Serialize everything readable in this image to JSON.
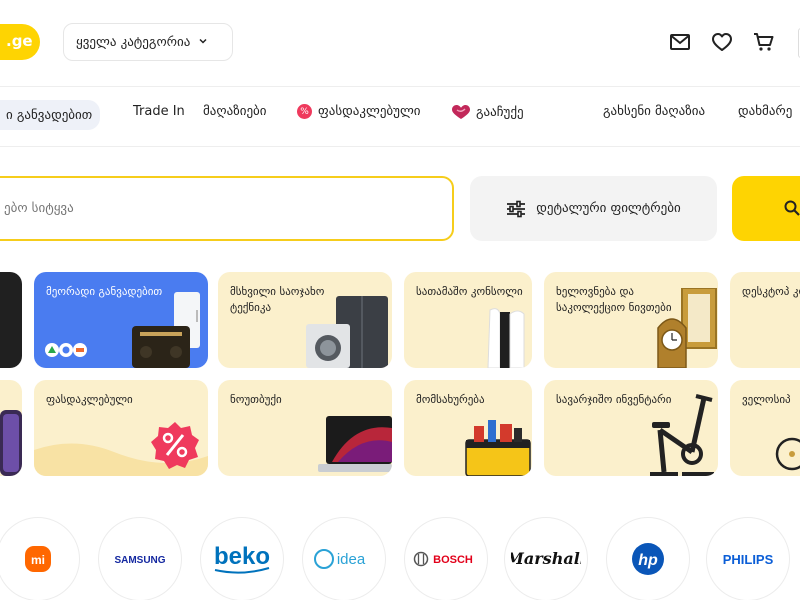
{
  "header": {
    "logo_text": ".ge",
    "category_button": "ყველა კატეგორია",
    "icons": [
      "mail-icon",
      "heart-icon",
      "cart-icon"
    ]
  },
  "nav": {
    "items": [
      {
        "label": "ი განვადებით",
        "active": true
      },
      {
        "label": "Trade In"
      },
      {
        "label": "მაღაზიები"
      },
      {
        "label": "ფასდაკლებული",
        "icon": "percent-badge-icon"
      },
      {
        "label": "გააჩუქე",
        "icon": "heart-gift-icon"
      },
      {
        "label": "გახსენი მაღაზია"
      },
      {
        "label": "დახმარე"
      }
    ]
  },
  "search": {
    "placeholder": "ებო სიტყვა",
    "filters_label": "დეტალური ფილტრები"
  },
  "categories": {
    "row1": [
      {
        "label": "მეორადი განვადებით"
      },
      {
        "label": "მსხვილი საოჯახო ტექნიკა"
      },
      {
        "label": "სათამაშო კონსოლი"
      },
      {
        "label": "ხელოვნება და საკოლექციო ნივთები"
      },
      {
        "label": "დესკტოპ კომპიუტ"
      }
    ],
    "row2": [
      {
        "label": "ფასდაკლებული"
      },
      {
        "label": "ნოუთბუქი"
      },
      {
        "label": "მომსახურება"
      },
      {
        "label": "სავარჯიშო ინვენტარი"
      },
      {
        "label": "ველოსიპ"
      }
    ]
  },
  "brands": [
    "mi",
    "SAMSUNG",
    "beko",
    "Midea",
    "BOSCH",
    "Marshall",
    "hp",
    "PHILIPS"
  ],
  "colors": {
    "brand_yellow": "#fed402",
    "card_bg": "#fbf0cc",
    "card_blue": "#4a7cf0",
    "sale_red": "#ef3a5d"
  }
}
